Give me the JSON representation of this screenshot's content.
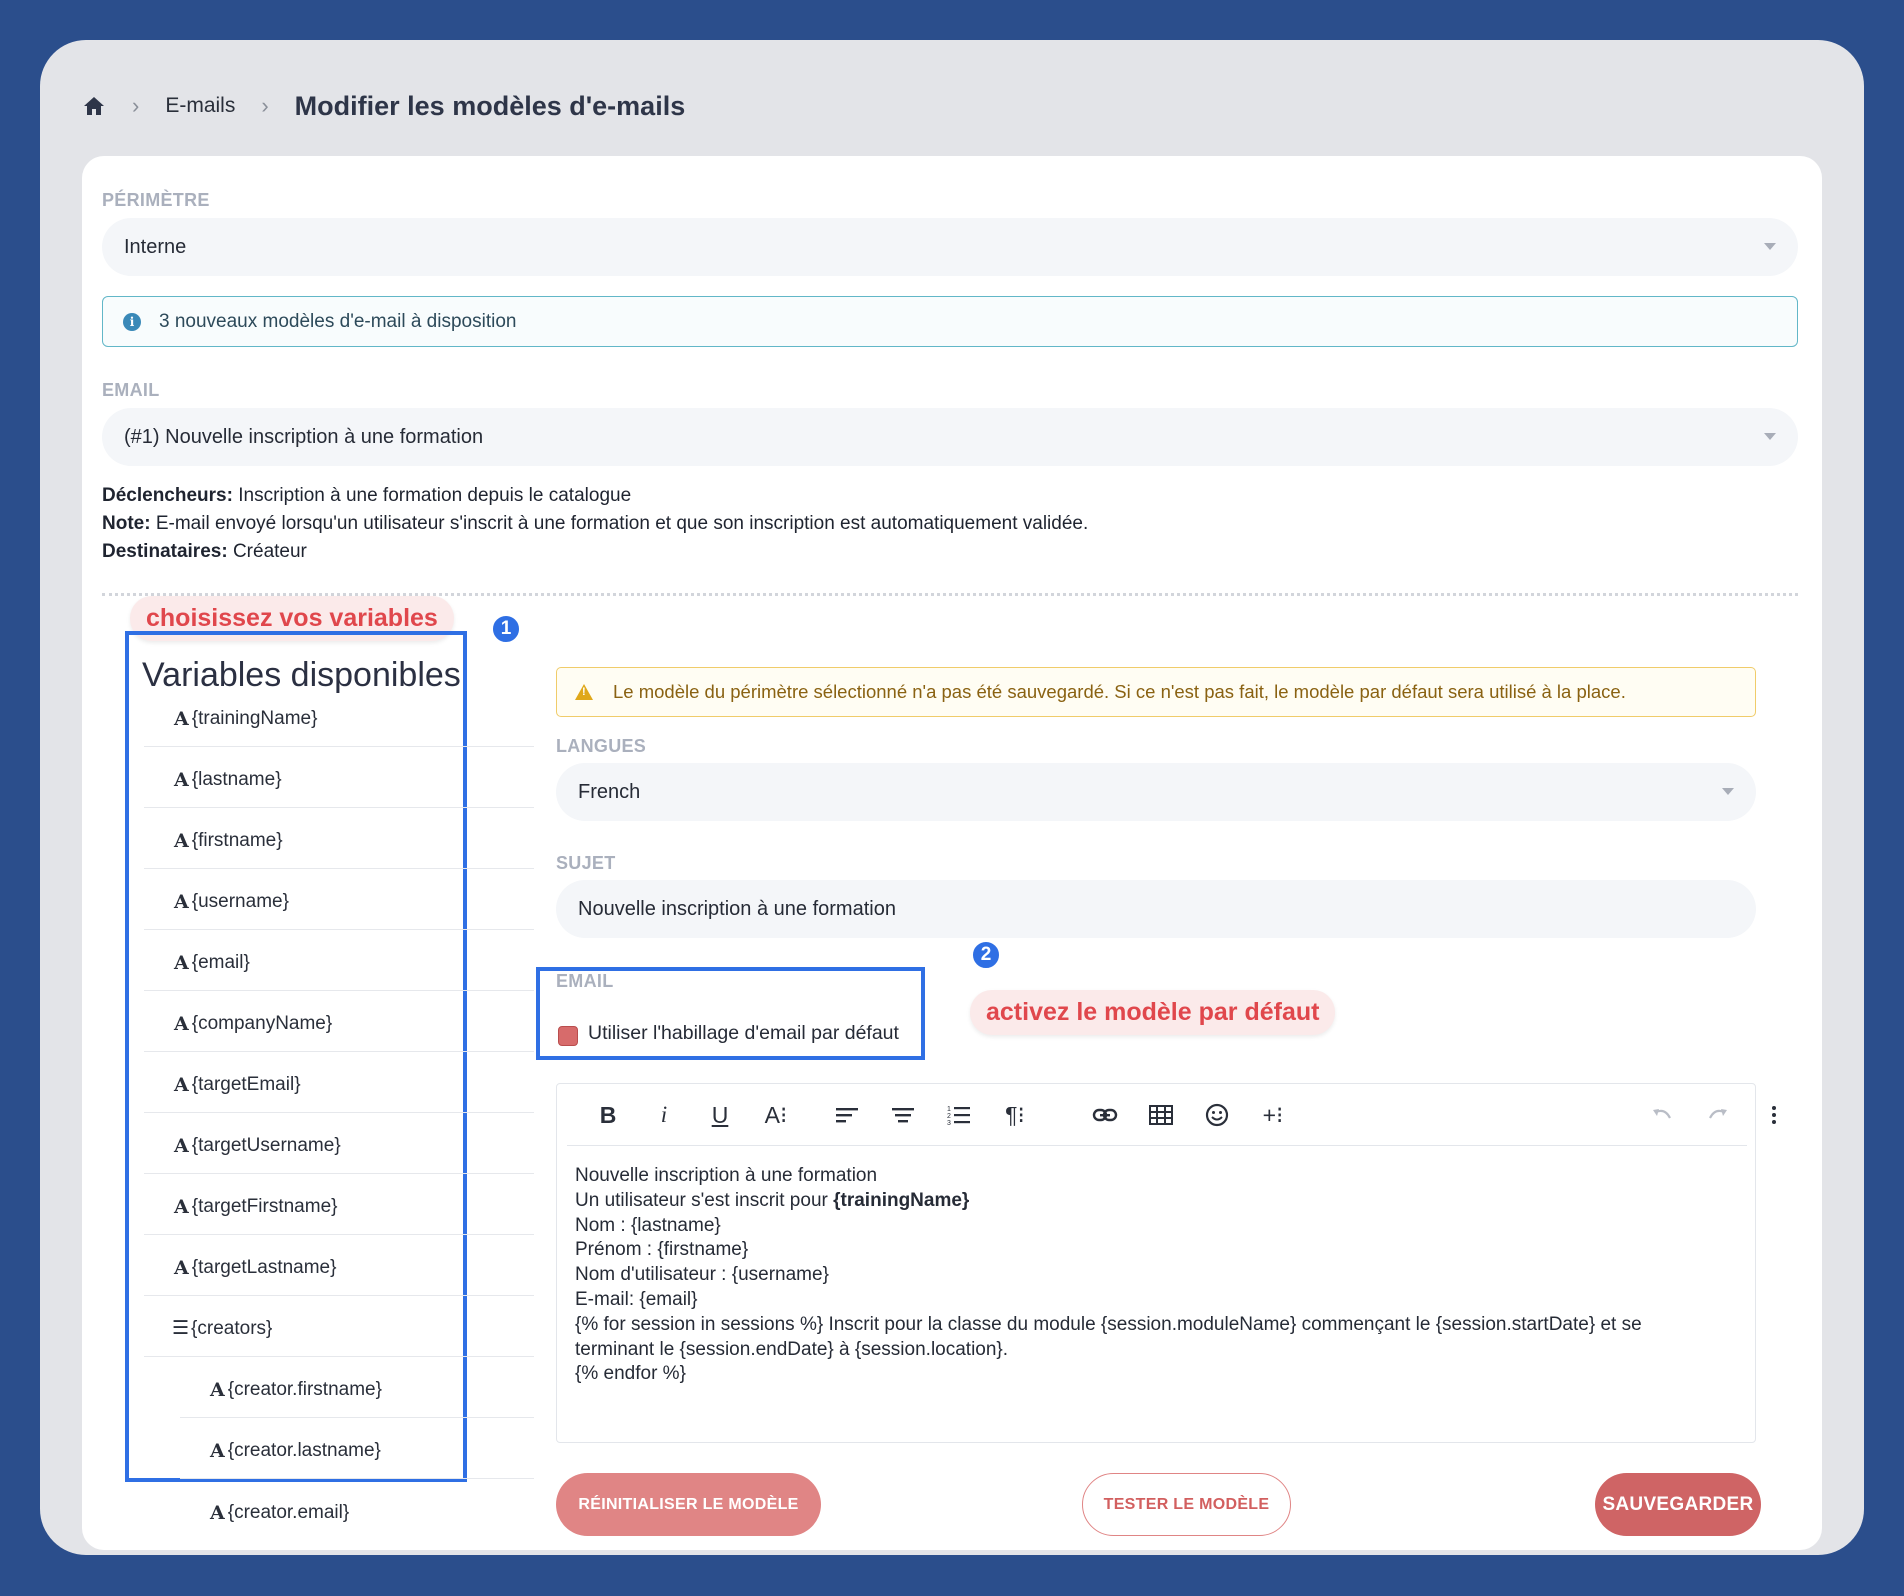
{
  "breadcrumb": {
    "home_icon": "home-icon",
    "separator": "›",
    "link": "E-mails",
    "current": "Modifier les modèles d'e-mails"
  },
  "perimeter": {
    "label": "PÉRIMÈTRE",
    "value": "Interne"
  },
  "info_banner": {
    "icon": "info-icon",
    "text": "3 nouveaux modèles d'e-mail à disposition"
  },
  "email_select": {
    "label": "EMAIL",
    "value": "(#1) Nouvelle inscription à une formation"
  },
  "meta": {
    "triggers_label": "Déclencheurs:",
    "triggers_value": " Inscription à une formation depuis le catalogue",
    "note_label": "Note:",
    "note_value": " E-mail envoyé lorsqu'un utilisateur s'inscrit à une formation et que son inscription est automatiquement validée.",
    "recipients_label": "Destinataires:",
    "recipients_value": " Créateur"
  },
  "annotations": {
    "choose_vars": "choisissez vos variables",
    "badge_1": "1",
    "activate_default": "activez le modèle par défaut",
    "badge_2": "2",
    "frame_color": "#2f6fe4"
  },
  "variables": {
    "title": "Variables disponibles",
    "items": [
      {
        "glyph": "A",
        "name": "{trainingName}"
      },
      {
        "glyph": "A",
        "name": "{lastname}"
      },
      {
        "glyph": "A",
        "name": "{firstname}"
      },
      {
        "glyph": "A",
        "name": "{username}"
      },
      {
        "glyph": "A",
        "name": "{email}"
      },
      {
        "glyph": "A",
        "name": "{companyName}"
      },
      {
        "glyph": "A",
        "name": "{targetEmail}"
      },
      {
        "glyph": "A",
        "name": "{targetUsername}"
      },
      {
        "glyph": "A",
        "name": "{targetFirstname}"
      },
      {
        "glyph": "A",
        "name": "{targetLastname}"
      },
      {
        "glyph": "☰",
        "name": "{creators}"
      },
      {
        "glyph": "A",
        "name": "{creator.firstname}"
      },
      {
        "glyph": "A",
        "name": "{creator.lastname}"
      },
      {
        "glyph": "A",
        "name": "{creator.email}"
      }
    ]
  },
  "warning": {
    "icon": "warning-icon",
    "text": "Le modèle du périmètre sélectionné n'a pas été sauvegardé. Si ce n'est pas fait, le modèle par défaut sera utilisé à la place."
  },
  "languages": {
    "label": "LANGUES",
    "value": "French"
  },
  "subject": {
    "label": "SUJET",
    "value": "Nouvelle inscription à une formation"
  },
  "email_section": {
    "label": "EMAIL",
    "checkbox_label": "Utiliser l'habillage d'email par défaut"
  },
  "toolbar": {
    "bold": "B",
    "italic": "i",
    "underline": "U",
    "font_size": "A⁝",
    "paragraph": "¶⁝",
    "insert": "+⁝"
  },
  "editor_lines": {
    "l1": "Nouvelle inscription à une formation",
    "l2_text": "Un utilisateur s'est inscrit pour ",
    "l2_bold": "{trainingName}",
    "l3": "Nom : {lastname}",
    "l4": "Prénom : {firstname}",
    "l5": "Nom d'utilisateur : {username}",
    "l6": "E-mail: {email}",
    "l7": "{% for session in sessions %} Inscrit pour la classe du module {session.moduleName} commençant le {session.startDate} et se",
    "l8": "terminant le {session.endDate} à {session.location}.",
    "l9": "{% endfor %}"
  },
  "buttons": {
    "reset": "RÉINITIALISER LE MODÈLE",
    "test": "TESTER LE MODÈLE",
    "save": "SAUVEGARDER"
  },
  "colors": {
    "background": "#2b4e8c",
    "primary": "#cf6465",
    "annotation": "#e0474c"
  }
}
